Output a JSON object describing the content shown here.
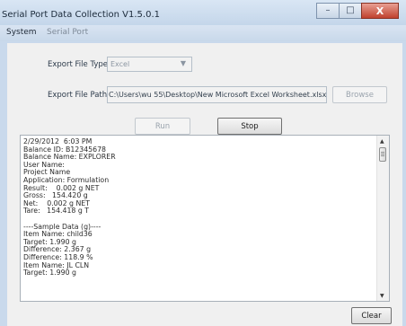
{
  "window": {
    "title": "Serial Port Data Collection   V1.5.0.1",
    "minimize_glyph": "–",
    "maximize_glyph": "□",
    "close_glyph": "X"
  },
  "menu": {
    "items": [
      {
        "label": "System",
        "enabled": true
      },
      {
        "label": "Serial Port",
        "enabled": false
      }
    ]
  },
  "export": {
    "file_type_label": "Export File Type:",
    "file_type_value": "Excel",
    "file_path_label": "Export File Path:",
    "file_path_value": "C:\\Users\\wu 55\\Desktop\\New Microsoft Excel Worksheet.xlsx",
    "browse_label": "Browse"
  },
  "controls": {
    "run_label": "Run",
    "stop_label": "Stop",
    "clear_label": "Clear"
  },
  "log": {
    "lines": [
      "2/29/2012  6:03 PM",
      "Balance ID: B12345678",
      "Balance Name: EXPLORER",
      "User Name:",
      "Project Name",
      "Application: Formulation",
      "Result:    0.002 g NET",
      "Gross:   154.420 g",
      "Net:    0.002 g NET",
      "Tare:   154.418 g T",
      "",
      "----Sample Data (g)----",
      "Item Name: child36",
      "Target: 1.990 g",
      "Difference: 2.367 g",
      "Difference: 118.9 %",
      "Item Name: JL CLN",
      "Target: 1.990 g"
    ]
  },
  "colors": {
    "titlebar": "#c9d9ec",
    "client": "#f0f0f0",
    "close_button": "#c0412e"
  }
}
